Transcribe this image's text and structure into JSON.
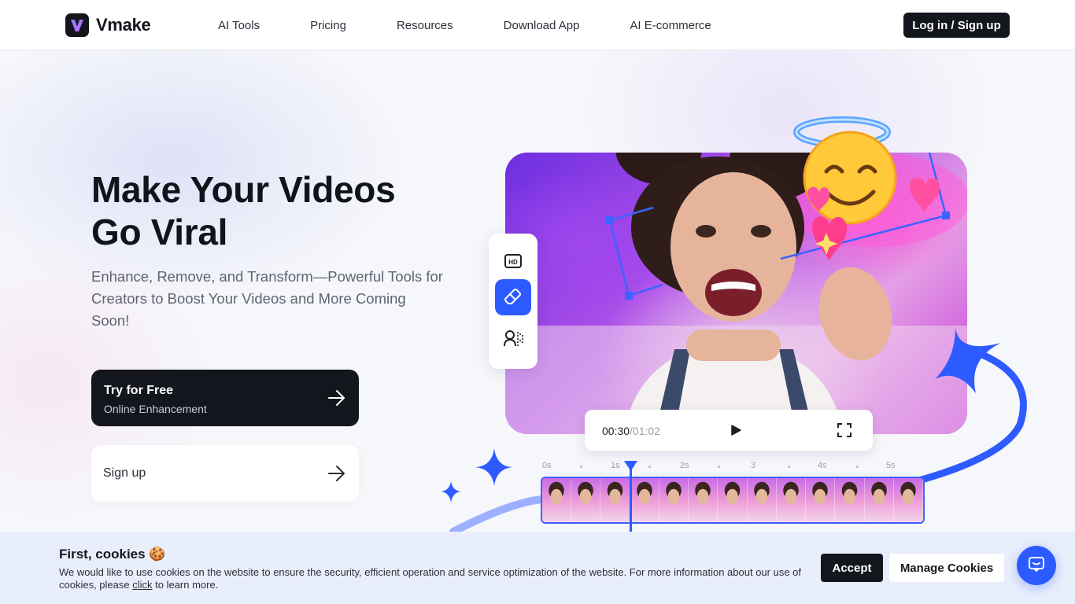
{
  "nav": {
    "brand": "Vmake",
    "links": [
      "AI Tools",
      "Pricing",
      "Resources",
      "Download App",
      "AI E-commerce"
    ],
    "login_label": "Log in / Sign up"
  },
  "hero": {
    "title_line1": "Make Your Videos",
    "title_line2": "Go Viral",
    "subtitle": "Enhance, Remove, and Transform—Powerful Tools for Creators to Boost Your Videos and More Coming Soon!",
    "cta_primary": {
      "label": "Try for Free",
      "sublabel": "Online Enhancement"
    },
    "cta_secondary": {
      "label": "Sign up"
    }
  },
  "player": {
    "current_time": "00:30",
    "total_time": "/01:02",
    "ruler_ticks": [
      "0s",
      "1s",
      "2s",
      "3",
      "4s",
      "5s"
    ],
    "tools": [
      "hd-icon",
      "eraser-icon",
      "person-remove-icon"
    ]
  },
  "cookie": {
    "title": "First, cookies",
    "emoji": "🍪",
    "text_before": "We would like to use cookies on the website to ensure the security, efficient operation and service optimization of the website. For more information about our use of cookies, please ",
    "link": "click",
    "text_after": " to learn more.",
    "accept_label": "Accept",
    "manage_label": "Manage Cookies"
  },
  "colors": {
    "accent": "#2e5bff",
    "dark": "#14161d",
    "cookie_bg": "#e9eefb"
  }
}
